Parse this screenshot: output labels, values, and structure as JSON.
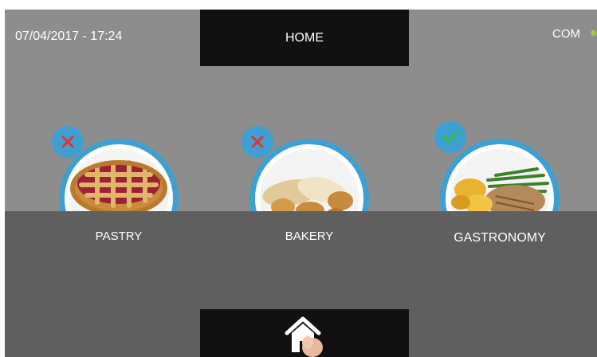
{
  "header": {
    "datetime": "07/04/2017 - 17:24",
    "title": "HOME",
    "status_label": "COM",
    "status_color": "#9ccf2a"
  },
  "categories": [
    {
      "label": "PASTRY",
      "status": "unavailable",
      "badge_icon": "x-icon"
    },
    {
      "label": "BAKERY",
      "status": "unavailable",
      "badge_icon": "x-icon"
    },
    {
      "label": "GASTRONOMY",
      "status": "selected",
      "badge_icon": "check-icon"
    }
  ],
  "footer": {
    "home_icon": "home-icon"
  },
  "colors": {
    "accent": "#3f9fd1",
    "unavailable": "#e6312e",
    "selected": "#2fbf3a"
  }
}
